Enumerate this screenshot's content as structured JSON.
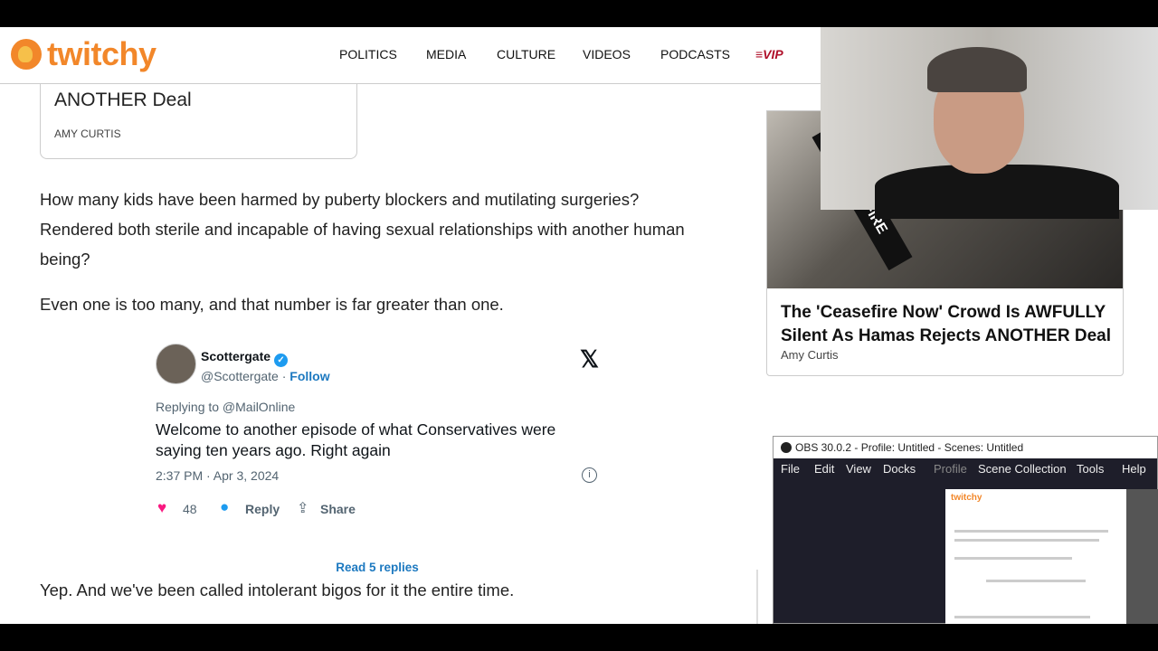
{
  "header": {
    "logo": "twitchy",
    "nav": [
      "POLITICS",
      "MEDIA",
      "CULTURE",
      "VIDEOS",
      "PODCASTS",
      "VIP"
    ]
  },
  "prev_card": {
    "title": "ANOTHER Deal",
    "author": "AMY CURTIS"
  },
  "article": {
    "p1": "How many kids have been harmed by puberty blockers and mutilating surgeries? Rendered both sterile and incapable of having sexual relationships with another human being?",
    "p2": "Even one is too many, and that number is far greater than one.",
    "p3": "Yep. And we've been called intolerant bigos for it the entire time."
  },
  "tweet": {
    "name": "Scottergate",
    "handle": "@Scottergate",
    "follow": "Follow",
    "separator": "·",
    "replying": "Replying to @MailOnline",
    "text": "Welcome to another episode of what Conservatives were saying ten years ago. Right again",
    "date": "2:37 PM · Apr 3, 2024",
    "likes": "48",
    "reply": "Reply",
    "share": "Share",
    "read_more": "Read 5 replies"
  },
  "side_card": {
    "image_text": "CEASEFIRE",
    "title": "The 'Ceasefire Now' Crowd Is AWFULLY Silent As Hamas Rejects ANOTHER Deal",
    "author": "Amy Curtis"
  },
  "obs": {
    "title": "OBS 30.0.2 - Profile: Untitled - Scenes: Untitled",
    "menu": [
      "File",
      "Edit",
      "View",
      "Docks",
      "Profile",
      "Scene Collection",
      "Tools",
      "Help"
    ],
    "preview_logo": "twitchy"
  },
  "colors": {
    "brand": "#f2872a",
    "link": "#1d79c0",
    "like": "#f91880",
    "vip": "#b0102a"
  }
}
